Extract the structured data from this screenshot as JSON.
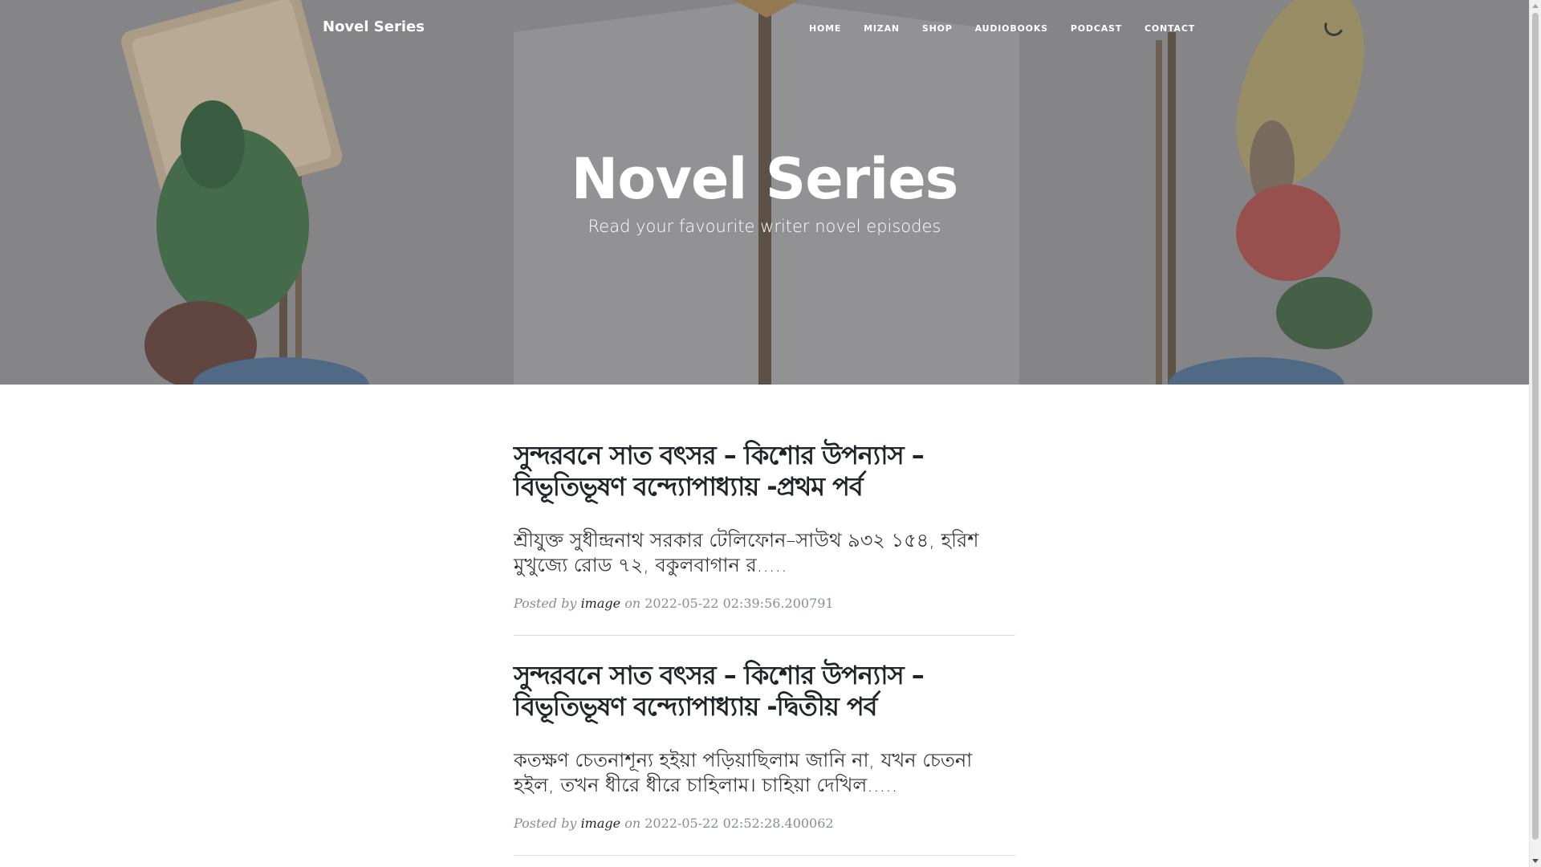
{
  "navbar": {
    "brand": "Novel Series",
    "links": [
      "HOME",
      "MIZAN",
      "SHOP",
      "AUDIOBOOKS",
      "PODCAST",
      "CONTACT"
    ]
  },
  "header": {
    "title": "Novel Series",
    "subheading": "Read your favourite writer novel episodes"
  },
  "posts": [
    {
      "title": "সুন্দরবনে সাত বৎসর – কিশোর উপন্যাস – বিভূতিভূষণ বন্দ্যোপাধ্যায় -প্রথম পর্ব",
      "excerpt": "শ্রীযুক্ত সুধীন্দ্রনাথ সরকার টেলিফোন–সাউথ ৯৩২ ১৫৪, হরিশ মুখুজ্যে রোড ৭২, বকুলবাগান র.....",
      "posted_by": "Posted by",
      "author": "image",
      "on": "on",
      "date": "2022-05-22 02:39:56.200791"
    },
    {
      "title": "সুন্দরবনে সাত বৎসর – কিশোর উপন্যাস – বিভূতিভূষণ বন্দ্যোপাধ্যায় -দ্বিতীয় পর্ব",
      "excerpt": "কতক্ষণ চেতনাশূন্য হইয়া পড়িয়াছিলাম জানি না, যখন চেতনা হইল, তখন ধীরে ধীরে চাহিলাম। চাহিয়া দেখিল.....",
      "posted_by": "Posted by",
      "author": "image",
      "on": "on",
      "date": "2022-05-22 02:52:28.400062"
    }
  ],
  "colors": {
    "masthead_bg": "#8a8a8c",
    "text_dark": "#212529",
    "meta_gray": "#868e96"
  }
}
